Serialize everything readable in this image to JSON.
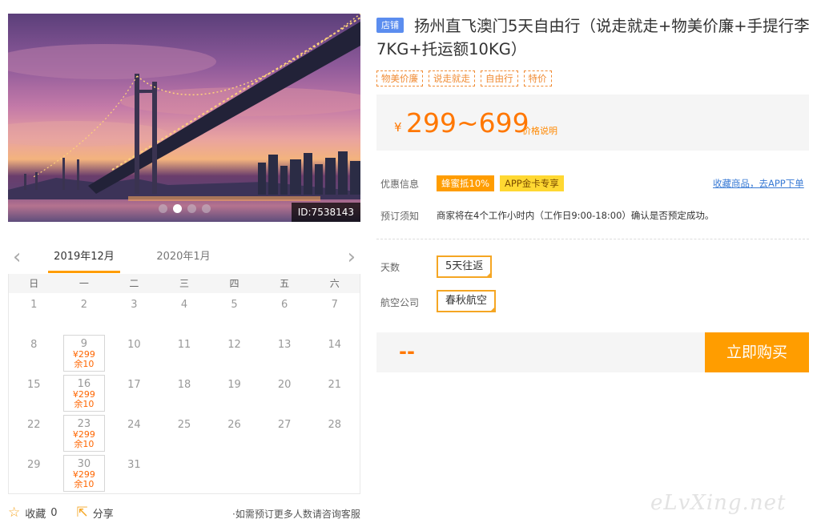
{
  "hero": {
    "id_label": "ID:7538143",
    "slides": 4,
    "active_slide": 2
  },
  "calendar": {
    "month_tabs": [
      "2019年12月",
      "2020年1月"
    ],
    "weekdays": [
      "日",
      "一",
      "二",
      "三",
      "四",
      "五",
      "六"
    ],
    "start_offset": 0,
    "days": [
      {
        "d": "1"
      },
      {
        "d": "2"
      },
      {
        "d": "3"
      },
      {
        "d": "4"
      },
      {
        "d": "5"
      },
      {
        "d": "6"
      },
      {
        "d": "7"
      },
      {
        "d": "8"
      },
      {
        "d": "9",
        "price": "¥299",
        "stock": "余10"
      },
      {
        "d": "10"
      },
      {
        "d": "11"
      },
      {
        "d": "12"
      },
      {
        "d": "13"
      },
      {
        "d": "14"
      },
      {
        "d": "15"
      },
      {
        "d": "16",
        "price": "¥299",
        "stock": "余10"
      },
      {
        "d": "17"
      },
      {
        "d": "18"
      },
      {
        "d": "19"
      },
      {
        "d": "20"
      },
      {
        "d": "21"
      },
      {
        "d": "22"
      },
      {
        "d": "23",
        "price": "¥299",
        "stock": "余10"
      },
      {
        "d": "24"
      },
      {
        "d": "25"
      },
      {
        "d": "26"
      },
      {
        "d": "27"
      },
      {
        "d": "28"
      },
      {
        "d": "29"
      },
      {
        "d": "30",
        "price": "¥299",
        "stock": "余10"
      },
      {
        "d": "31"
      }
    ]
  },
  "footer": {
    "favorite_label": "收藏",
    "favorite_count": "0",
    "share_label": "分享",
    "note": "·如需预订更多人数请咨询客服"
  },
  "product": {
    "store_badge": "店铺",
    "title": "扬州直飞澳门5天自由行（说走就走+物美价廉+手提行李7KG+托运额10KG）",
    "tags": [
      "物美价廉",
      "说走就走",
      "自由行",
      "特价"
    ],
    "currency": "¥",
    "price_range": "299~699",
    "price_note": "价格说明",
    "promo_label": "优惠信息",
    "promos": [
      "蜂蜜抵10%",
      "APP金卡专享"
    ],
    "fav_link": "收藏商品，去APP下单",
    "notice_label": "预订须知",
    "notice": "商家将在4个工作小时内（工作日9:00-18:00）确认是否预定成功。",
    "days_label": "天数",
    "days_option": "5天往返",
    "airline_label": "航空公司",
    "airline_option": "春秋航空",
    "total": "--",
    "buy_label": "立即购买"
  },
  "watermark": "eLvXing.net",
  "colors": {
    "accent": "#ff9d00",
    "price": "#ff7700",
    "link": "#3a7bd5",
    "badge": "#5b8def"
  },
  "icons": {
    "favorite": "star-outline-icon",
    "share": "share-icon",
    "prev": "chevron-left-icon",
    "next": "chevron-right-icon"
  }
}
